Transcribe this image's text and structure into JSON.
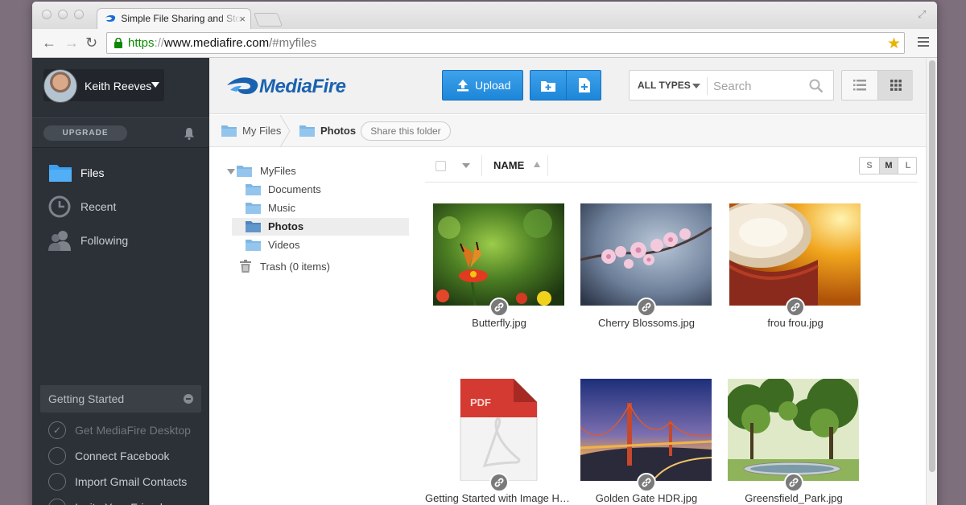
{
  "browser": {
    "tab_title": "Simple File Sharing and Storage",
    "url_scheme": "https",
    "url_sep": "://",
    "url_host": "www.mediafire.com",
    "url_path": "/#myfiles"
  },
  "sidebar": {
    "user_name": "Keith Reeves",
    "upgrade_label": "UPGRADE",
    "nav": [
      {
        "label": "Files",
        "icon": "folder-icon",
        "active": true
      },
      {
        "label": "Recent",
        "icon": "clock-icon",
        "active": false
      },
      {
        "label": "Following",
        "icon": "people-icon",
        "active": false
      }
    ],
    "getting_started": {
      "title": "Getting Started",
      "items": [
        {
          "label": "Get MediaFire Desktop",
          "done": true
        },
        {
          "label": "Connect Facebook",
          "done": false
        },
        {
          "label": "Import Gmail Contacts",
          "done": false
        },
        {
          "label": "Invite Your Friends",
          "done": false
        }
      ]
    }
  },
  "header": {
    "brand": "MediaFire",
    "upload_label": "Upload",
    "filter_label": "ALL TYPES",
    "search_placeholder": "Search"
  },
  "breadcrumb": {
    "items": [
      "My Files",
      "Photos"
    ],
    "share_label": "Share this folder"
  },
  "tree": {
    "root": "MyFiles",
    "folders": [
      "Documents",
      "Music",
      "Photos",
      "Videos"
    ],
    "active": "Photos",
    "trash": "Trash (0 items)"
  },
  "list": {
    "column_name": "NAME",
    "sizes": [
      "S",
      "M",
      "L"
    ],
    "active_size": "M",
    "files": [
      {
        "name": "Butterfly.jpg"
      },
      {
        "name": "Cherry Blossoms.jpg"
      },
      {
        "name": "frou frou.jpg"
      },
      {
        "name": "Getting Started with Image Hosting.pdf",
        "type_badge": "PDF"
      },
      {
        "name": "Golden Gate HDR.jpg"
      },
      {
        "name": "Greensfield_Park.jpg"
      }
    ]
  },
  "colors": {
    "brand_blue": "#1a62b0",
    "button_blue": "#2b93e2",
    "sidebar_bg": "#2c3138",
    "folder_blue": "#7fb7e3"
  }
}
